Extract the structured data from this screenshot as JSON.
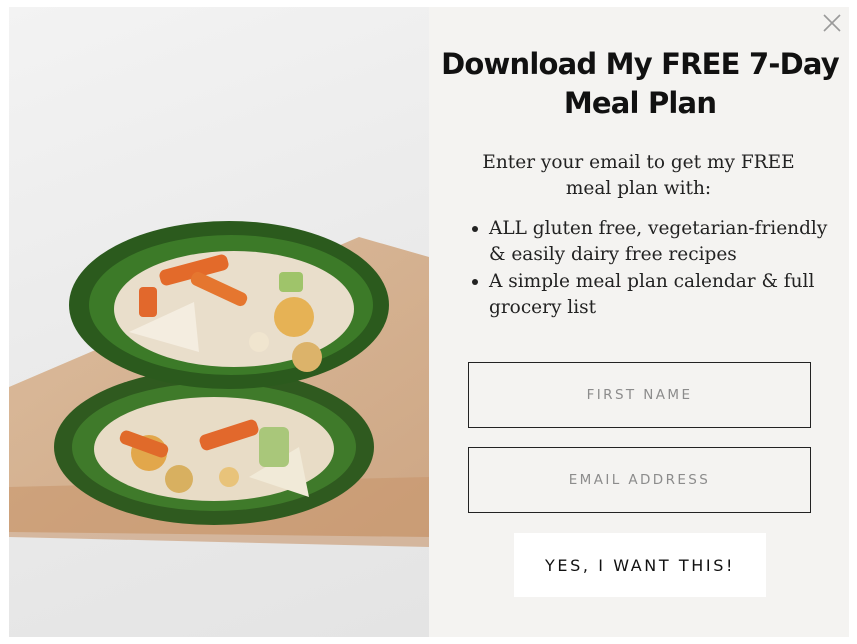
{
  "popup": {
    "close_icon": "close-icon",
    "headline": "Download My FREE 7-Day Meal Plan",
    "intro": "Enter your email to get my FREE meal plan with:",
    "bullets": [
      "ALL gluten free, vegetarian-friendly & easily dairy free recipes",
      "A simple meal plan calendar & full grocery list"
    ],
    "first_name_placeholder": "FIRST NAME",
    "email_placeholder": "EMAIL ADDRESS",
    "submit_label": "YES, I WANT THIS!",
    "image": "spinach-wrap-photo"
  },
  "colors": {
    "panel_background": "#f4f3f1",
    "text": "#111111",
    "button_background": "#ffffff",
    "field_border": "#222222"
  }
}
